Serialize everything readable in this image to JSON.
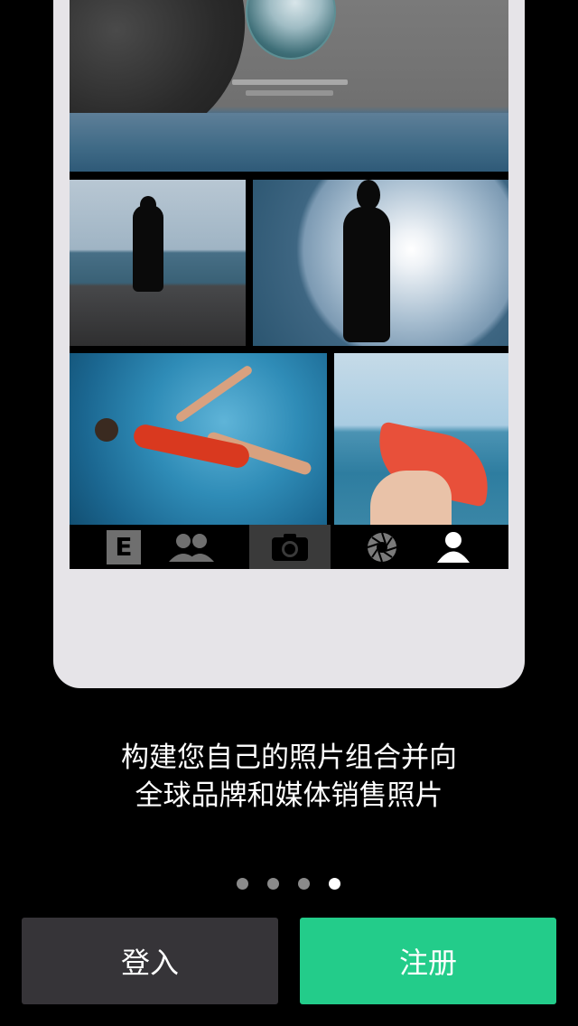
{
  "caption": {
    "line1": "构建您自己的照片组合并向",
    "line2": "全球品牌和媒体销售照片"
  },
  "pager": {
    "total": 4,
    "current": 4
  },
  "buttons": {
    "login": "登入",
    "signup": "注册"
  },
  "mockup_toolbar": {
    "items": [
      "e-icon",
      "people-icon",
      "camera-icon",
      "aperture-icon",
      "profile-icon"
    ],
    "e_letter": "E"
  },
  "colors": {
    "signup_accent": "#23cc8a",
    "login_bg": "#363438",
    "background": "#000000"
  }
}
